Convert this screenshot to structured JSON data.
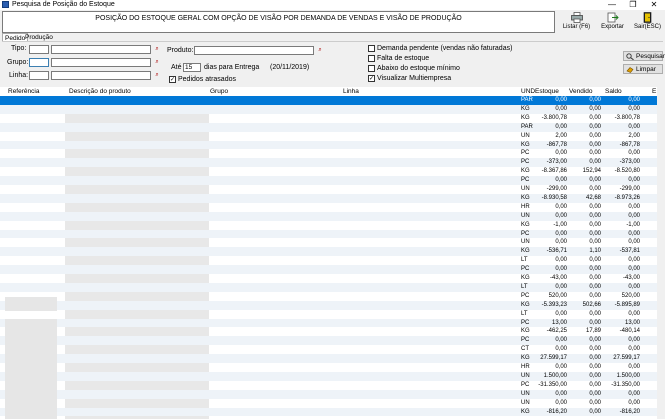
{
  "window": {
    "title": "Pesquisa de Posição do Estoque",
    "minimize": "—",
    "restore": "❐",
    "close": "✕"
  },
  "header": {
    "text": "POSIÇÃO DO ESTOQUE GERAL COM OPÇÃO DE VISÃO POR DEMANDA DE VENDAS E VISÃO DE PRODUÇÃO"
  },
  "toolbar": {
    "list_label": "Listar (F6)",
    "export_label": "Exportar",
    "exit_label": "Sair(ESC)"
  },
  "tabs": [
    {
      "label": "Pedido"
    },
    {
      "label": "Produção"
    }
  ],
  "filters": {
    "tipo_label": "Tipo:",
    "grupo_label": "Grupo:",
    "linha_label": "Linha:",
    "produto_label": "Produto:",
    "ate_label": "Até",
    "ate_value": "15",
    "dias_label": "dias para Entrega",
    "date_text": "(20/11/2019)",
    "pedidos_atrasados": "Pedidos atrasados",
    "demanda_pendente": "Demanda pendente (vendas não faturadas)",
    "falta_estoque": "Falta de estoque",
    "abaixo_minimo": "Abaixo do estoque mínimo",
    "visualizar_multi": "Visualizar Multiempresa",
    "pesquisar": "Pesquisar",
    "limpar": "Limpar"
  },
  "grid": {
    "columns": [
      "Referência",
      "Descrição do produto",
      "Grupo",
      "Linha",
      "UND",
      "Estoque",
      "Vendido",
      "Saldo",
      "E"
    ],
    "rows": [
      {
        "und": "PAR",
        "estoque": "0,00",
        "vendido": "0,00",
        "saldo": "0,00"
      },
      {
        "und": "KG",
        "estoque": "0,00",
        "vendido": "0,00",
        "saldo": "0,00"
      },
      {
        "und": "KG",
        "estoque": "-3.800,78",
        "vendido": "0,00",
        "saldo": "-3.800,78"
      },
      {
        "und": "PAR",
        "estoque": "0,00",
        "vendido": "0,00",
        "saldo": "0,00"
      },
      {
        "und": "UN",
        "estoque": "2,00",
        "vendido": "0,00",
        "saldo": "2,00"
      },
      {
        "und": "KG",
        "estoque": "-867,78",
        "vendido": "0,00",
        "saldo": "-867,78"
      },
      {
        "und": "PC",
        "estoque": "0,00",
        "vendido": "0,00",
        "saldo": "0,00"
      },
      {
        "und": "PC",
        "estoque": "-373,00",
        "vendido": "0,00",
        "saldo": "-373,00"
      },
      {
        "und": "KG",
        "estoque": "-8.367,86",
        "vendido": "152,94",
        "saldo": "-8.520,80"
      },
      {
        "und": "PC",
        "estoque": "0,00",
        "vendido": "0,00",
        "saldo": "0,00"
      },
      {
        "und": "UN",
        "estoque": "-299,00",
        "vendido": "0,00",
        "saldo": "-299,00"
      },
      {
        "und": "KG",
        "estoque": "-8.930,58",
        "vendido": "42,68",
        "saldo": "-8.973,26"
      },
      {
        "und": "HR",
        "estoque": "0,00",
        "vendido": "0,00",
        "saldo": "0,00"
      },
      {
        "und": "UN",
        "estoque": "0,00",
        "vendido": "0,00",
        "saldo": "0,00"
      },
      {
        "und": "KG",
        "estoque": "-1,00",
        "vendido": "0,00",
        "saldo": "-1,00"
      },
      {
        "und": "PC",
        "estoque": "0,00",
        "vendido": "0,00",
        "saldo": "0,00"
      },
      {
        "und": "UN",
        "estoque": "0,00",
        "vendido": "0,00",
        "saldo": "0,00"
      },
      {
        "und": "KG",
        "estoque": "-536,71",
        "vendido": "1,10",
        "saldo": "-537,81"
      },
      {
        "und": "LT",
        "estoque": "0,00",
        "vendido": "0,00",
        "saldo": "0,00"
      },
      {
        "und": "PC",
        "estoque": "0,00",
        "vendido": "0,00",
        "saldo": "0,00"
      },
      {
        "und": "KG",
        "estoque": "-43,00",
        "vendido": "0,00",
        "saldo": "-43,00"
      },
      {
        "und": "LT",
        "estoque": "0,00",
        "vendido": "0,00",
        "saldo": "0,00"
      },
      {
        "und": "PC",
        "estoque": "520,00",
        "vendido": "0,00",
        "saldo": "520,00"
      },
      {
        "und": "KG",
        "estoque": "-5.393,23",
        "vendido": "502,66",
        "saldo": "-5.895,89"
      },
      {
        "und": "LT",
        "estoque": "0,00",
        "vendido": "0,00",
        "saldo": "0,00"
      },
      {
        "und": "PC",
        "estoque": "13,00",
        "vendido": "0,00",
        "saldo": "13,00"
      },
      {
        "und": "KG",
        "estoque": "-462,25",
        "vendido": "17,89",
        "saldo": "-480,14"
      },
      {
        "und": "PC",
        "estoque": "0,00",
        "vendido": "0,00",
        "saldo": "0,00"
      },
      {
        "und": "CT",
        "estoque": "0,00",
        "vendido": "0,00",
        "saldo": "0,00"
      },
      {
        "und": "KG",
        "estoque": "27.599,17",
        "vendido": "0,00",
        "saldo": "27.599,17"
      },
      {
        "und": "HR",
        "estoque": "0,00",
        "vendido": "0,00",
        "saldo": "0,00"
      },
      {
        "und": "UN",
        "estoque": "1.500,00",
        "vendido": "0,00",
        "saldo": "1.500,00"
      },
      {
        "und": "PC",
        "estoque": "-31.350,00",
        "vendido": "0,00",
        "saldo": "-31.350,00"
      },
      {
        "und": "UN",
        "estoque": "0,00",
        "vendido": "0,00",
        "saldo": "0,00"
      },
      {
        "und": "UN",
        "estoque": "0,00",
        "vendido": "0,00",
        "saldo": "0,00"
      },
      {
        "und": "KG",
        "estoque": "-816,20",
        "vendido": "0,00",
        "saldo": "-816,20"
      }
    ]
  }
}
